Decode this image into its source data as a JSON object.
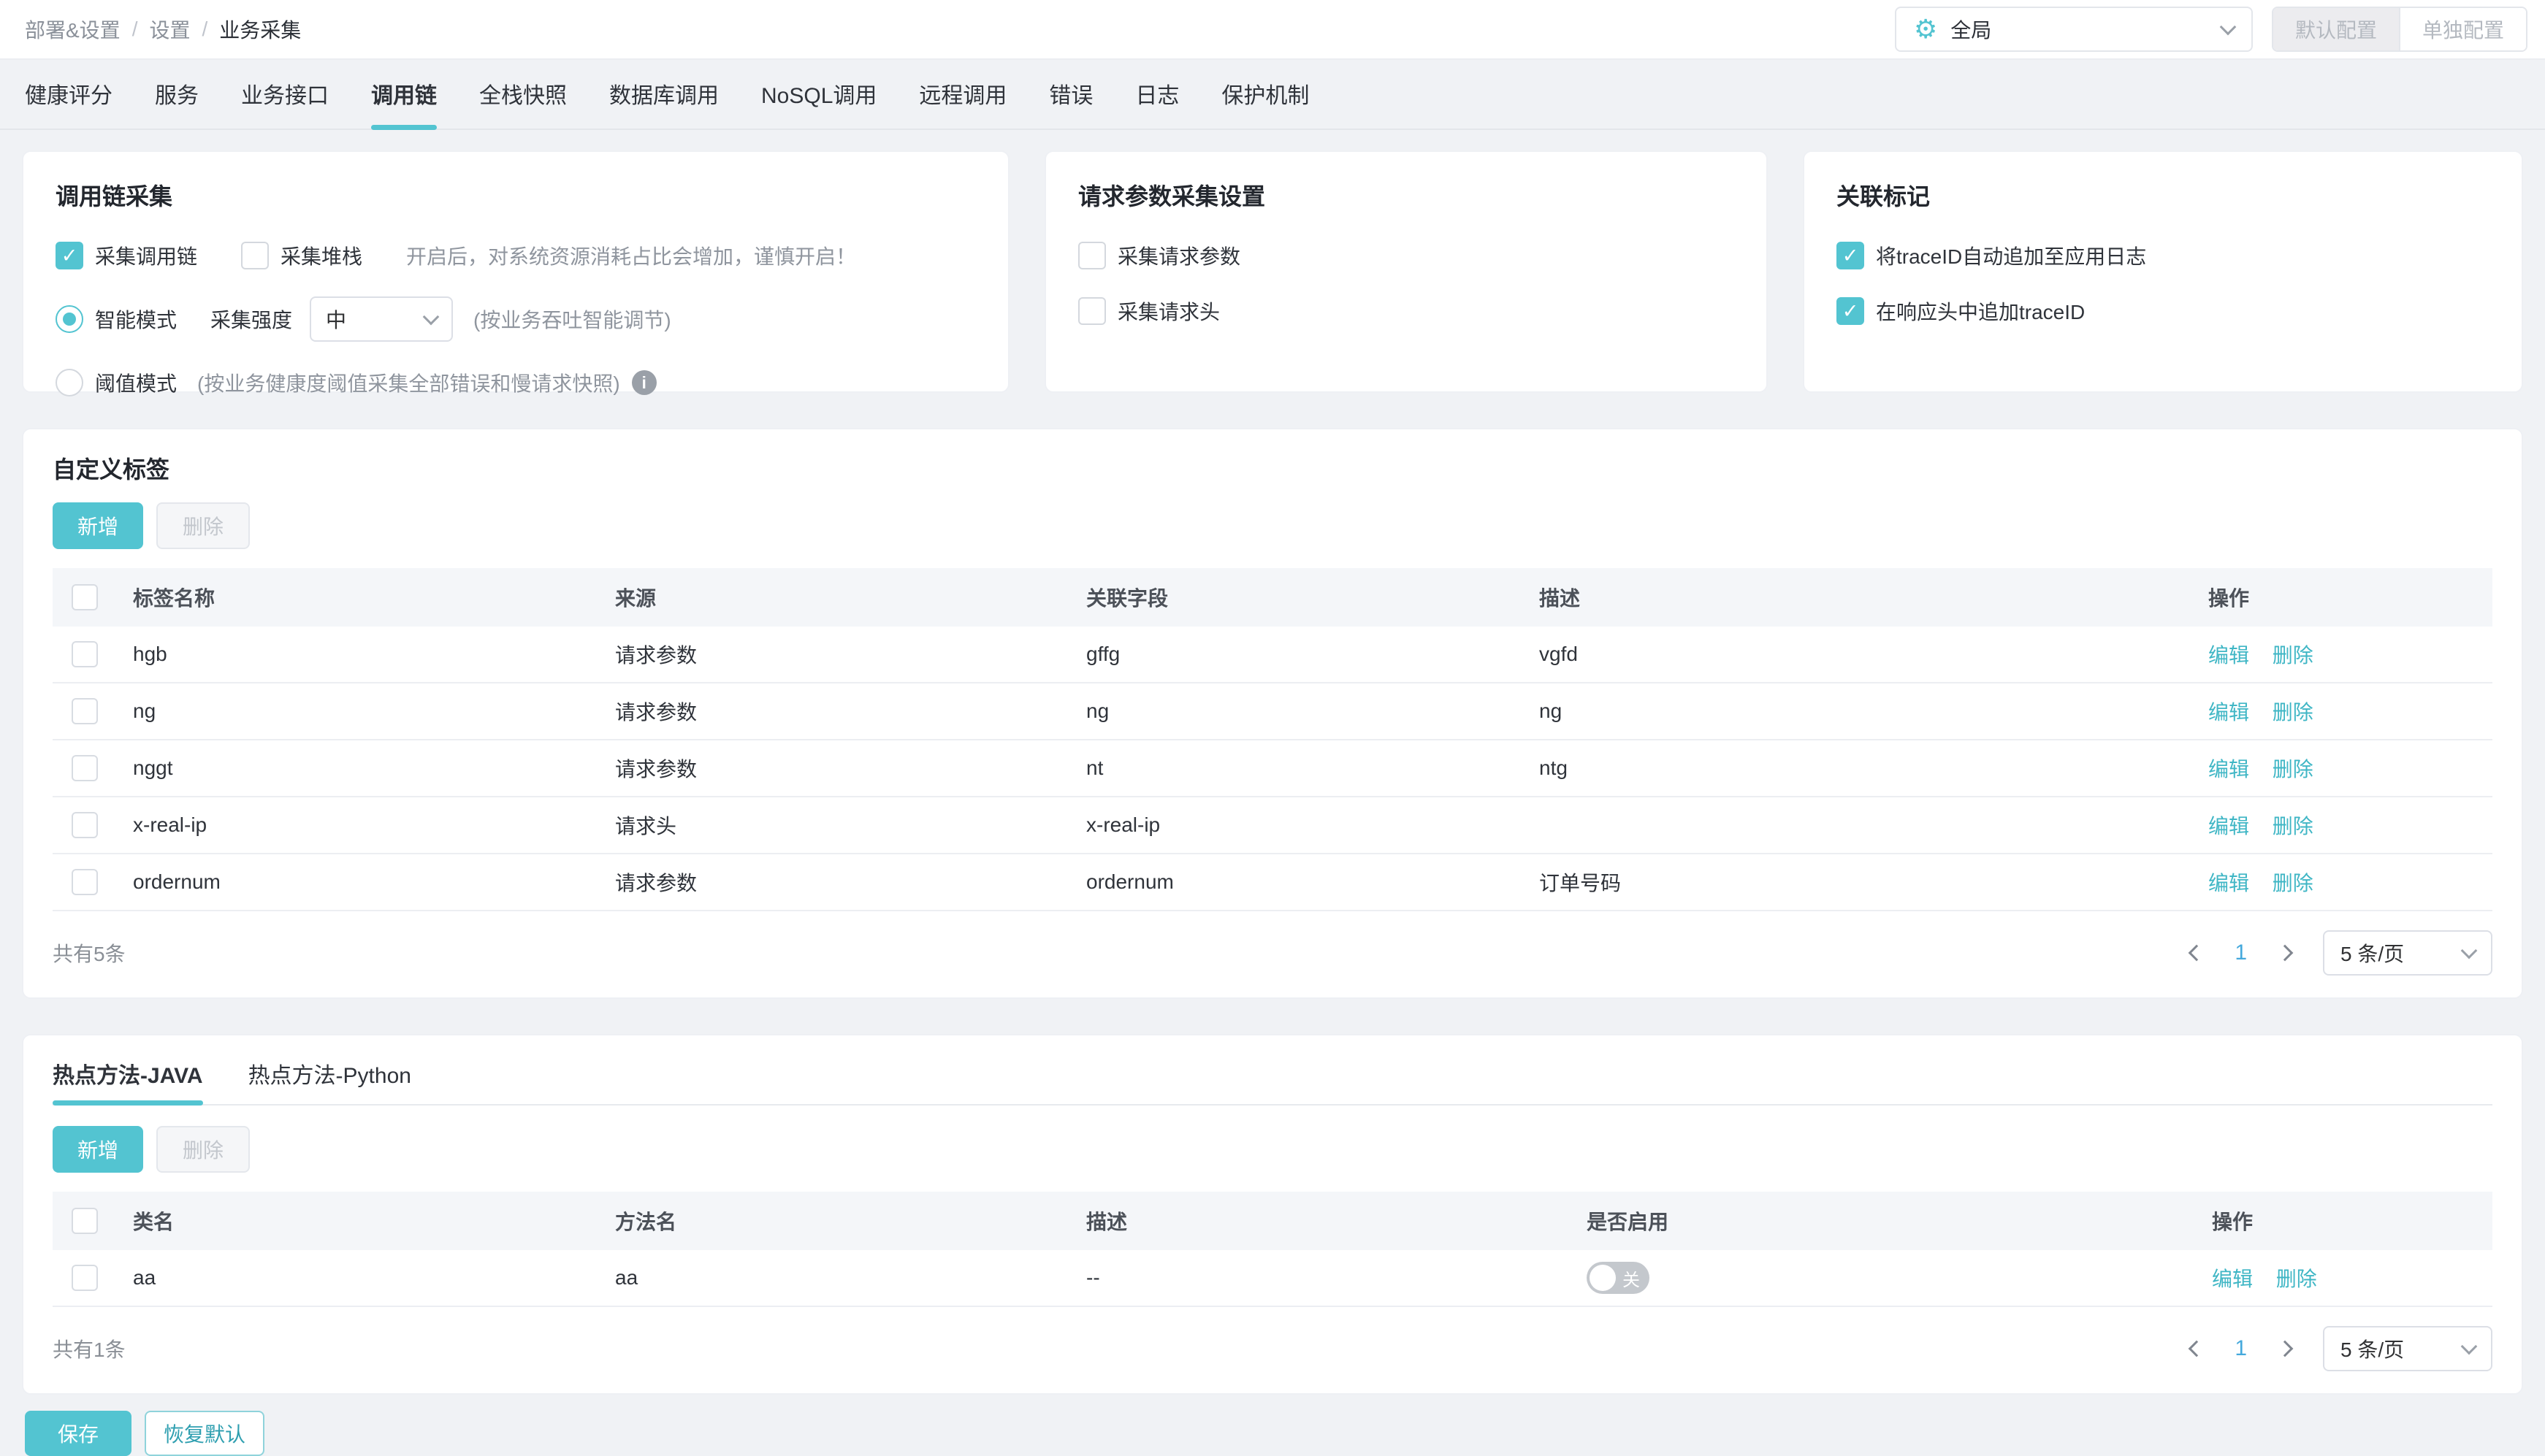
{
  "breadcrumb": {
    "items": [
      "部署&设置",
      "设置",
      "业务采集"
    ],
    "separator": "/"
  },
  "topbar": {
    "scope_value": "全局",
    "scope_icon": "gear-icon",
    "default_config_label": "默认配置",
    "separate_config_label": "单独配置"
  },
  "tabs": {
    "active": "调用链",
    "items": [
      {
        "label": "健康评分"
      },
      {
        "label": "服务"
      },
      {
        "label": "业务接口"
      },
      {
        "label": "调用链"
      },
      {
        "label": "全栈快照"
      },
      {
        "label": "数据库调用"
      },
      {
        "label": "NoSQL调用"
      },
      {
        "label": "远程调用"
      },
      {
        "label": "错误"
      },
      {
        "label": "日志"
      },
      {
        "label": "保护机制"
      }
    ]
  },
  "cards": {
    "trace": {
      "title": "调用链采集",
      "collect_trace": {
        "label": "采集调用链",
        "checked": true
      },
      "collect_stack": {
        "label": "采集堆栈",
        "checked": false
      },
      "stack_hint": "开启后，对系统资源消耗占比会增加，谨慎开启！",
      "smart_mode": {
        "label": "智能模式",
        "selected": true,
        "intensity_label": "采集强度",
        "intensity_value": "中",
        "hint": "(按业务吞吐智能调节)"
      },
      "threshold_mode": {
        "label": "阈值模式",
        "selected": false,
        "hint": "(按业务健康度阈值采集全部错误和慢请求快照)"
      }
    },
    "request": {
      "title": "请求参数采集设置",
      "collect_params": {
        "label": "采集请求参数",
        "checked": false
      },
      "collect_headers": {
        "label": "采集请求头",
        "checked": false
      }
    },
    "correlation": {
      "title": "关联标记",
      "trace_to_log": {
        "label": "将traceID自动追加至应用日志",
        "checked": true
      },
      "trace_to_header": {
        "label": "在响应头中追加traceID",
        "checked": true
      }
    }
  },
  "custom_tags": {
    "title": "自定义标签",
    "add_label": "新增",
    "delete_label": "删除",
    "columns": {
      "name": "标签名称",
      "source": "来源",
      "field": "关联字段",
      "desc": "描述",
      "action": "操作"
    },
    "rows": [
      {
        "name": "hgb",
        "source": "请求参数",
        "field": "gffg",
        "desc": "vgfd"
      },
      {
        "name": "ng",
        "source": "请求参数",
        "field": "ng",
        "desc": "ng"
      },
      {
        "name": "nggt",
        "source": "请求参数",
        "field": "nt",
        "desc": "ntg"
      },
      {
        "name": "x-real-ip",
        "source": "请求头",
        "field": "x-real-ip",
        "desc": ""
      },
      {
        "name": "ordernum",
        "source": "请求参数",
        "field": "ordernum",
        "desc": "订单号码"
      }
    ],
    "edit_label": "编辑",
    "remove_label": "删除",
    "total_text": "共有5条",
    "pagination": {
      "current": "1",
      "page_size": "5 条/页"
    }
  },
  "hot_methods": {
    "tabs": [
      {
        "label": "热点方法-JAVA",
        "active": true
      },
      {
        "label": "热点方法-Python",
        "active": false
      }
    ],
    "add_label": "新增",
    "delete_label": "删除",
    "columns": {
      "class": "类名",
      "method": "方法名",
      "desc": "描述",
      "enabled": "是否启用",
      "action": "操作"
    },
    "rows": [
      {
        "class": "aa",
        "method": "aa",
        "desc": "--",
        "enabled": false,
        "toggle_label": "关"
      }
    ],
    "edit_label": "编辑",
    "remove_label": "删除",
    "total_text": "共有1条",
    "pagination": {
      "current": "1",
      "page_size": "5 条/页"
    }
  },
  "footer": {
    "save_label": "保存",
    "reset_label": "恢复默认"
  },
  "colors": {
    "primary": "#53c4d1",
    "link": "#3fb6c5",
    "page_active": "#45a9dc",
    "page_bg": "#f0f2f5"
  }
}
